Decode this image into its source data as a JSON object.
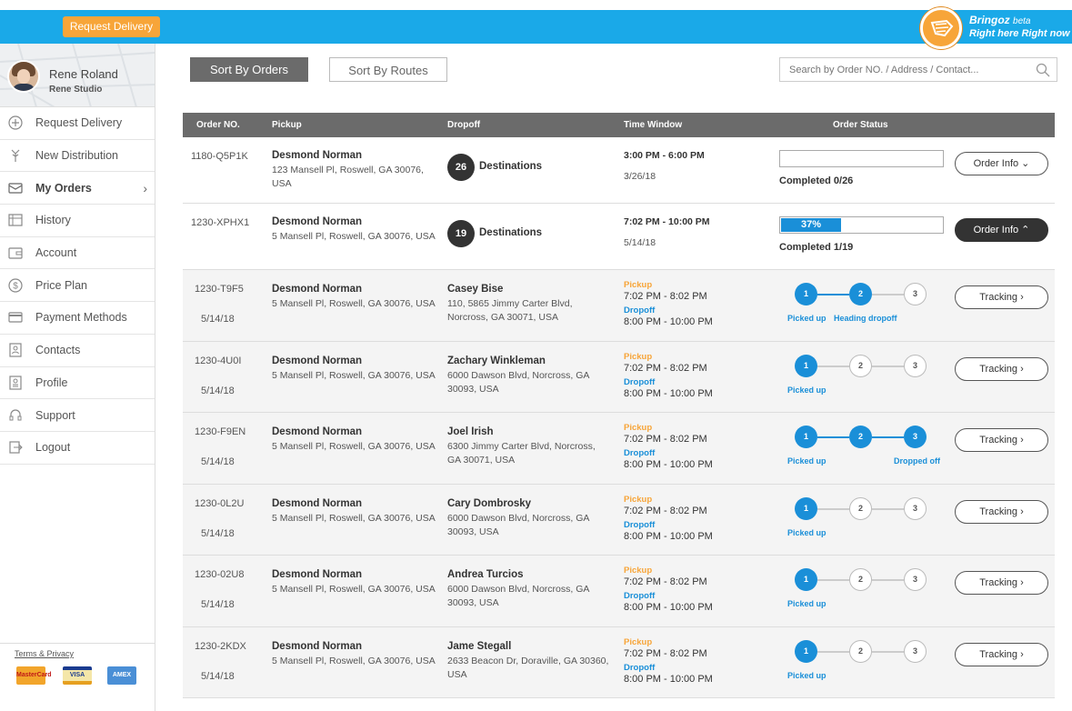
{
  "header": {
    "request_button": "Request Delivery",
    "brand_name": "Bringoz",
    "brand_beta": "beta",
    "brand_tagline": "Right here Right now",
    "colors": {
      "topbar": "#1aa9e8",
      "accent": "#f7a539",
      "blue": "#1a8fd8"
    }
  },
  "profile": {
    "name": "Rene Roland",
    "company": "Rene Studio"
  },
  "sidebar": {
    "items": [
      {
        "label": "Request Delivery",
        "icon": "plus-circle-icon"
      },
      {
        "label": "New Distribution",
        "icon": "fork-icon"
      },
      {
        "label": "My Orders",
        "icon": "inbox-icon",
        "active": true
      },
      {
        "label": "History",
        "icon": "history-icon"
      },
      {
        "label": "Account",
        "icon": "wallet-icon"
      },
      {
        "label": "Price Plan",
        "icon": "dollar-icon"
      },
      {
        "label": "Payment Methods",
        "icon": "credit-card-icon"
      },
      {
        "label": "Contacts",
        "icon": "contacts-icon"
      },
      {
        "label": "Profile",
        "icon": "profile-icon"
      },
      {
        "label": "Support",
        "icon": "headset-icon"
      },
      {
        "label": "Logout",
        "icon": "logout-icon"
      }
    ],
    "terms": "Terms & Privacy",
    "cards": [
      "MasterCard",
      "VISA",
      "AMEX"
    ]
  },
  "toolbar": {
    "sort_orders": "Sort By Orders",
    "sort_routes": "Sort By Routes",
    "search_placeholder": "Search by Order NO. / Address / Contact..."
  },
  "table": {
    "headers": {
      "order_no": "Order NO.",
      "pickup": "Pickup",
      "dropoff": "Dropoff",
      "time_window": "Time Window",
      "order_status": "Order Status"
    }
  },
  "routes": [
    {
      "order_no": "1180-Q5P1K",
      "pickup_name": "Desmond Norman",
      "pickup_addr": "123 Mansell Pl, Roswell, GA 30076, USA",
      "destinations_count": "26",
      "destinations_label": "Destinations",
      "time": "3:00 PM - 6:00 PM",
      "date": "3/26/18",
      "progress": 0,
      "progress_label": "",
      "completed": "Completed 0/26",
      "button": "Order Info ⌄"
    },
    {
      "order_no": "1230-XPHX1",
      "pickup_name": "Desmond Norman",
      "pickup_addr": "5 Mansell Pl, Roswell, GA 30076, USA",
      "destinations_count": "19",
      "destinations_label": "Destinations",
      "time": "7:02 PM - 10:00 PM",
      "date": "5/14/18",
      "progress": 0.37,
      "progress_label": "37%",
      "completed": "Completed 1/19",
      "button": "Order Info ⌃"
    }
  ],
  "orders": [
    {
      "order_no": "1230-T9F5",
      "date": "5/14/18",
      "pickup_name": "Desmond Norman",
      "pickup_addr": "5 Mansell Pl, Roswell, GA 30076, USA",
      "drop_name": "Casey Bise",
      "drop_addr": "110, 5865 Jimmy Carter Blvd, Norcross, GA 30071, USA",
      "pickup_label": "Pickup",
      "pickup_time": "7:02 PM - 8:02 PM",
      "dropoff_label": "Dropoff",
      "dropoff_time": "8:00 PM - 10:00 PM",
      "steps": [
        true,
        true,
        false
      ],
      "label1": "Picked up",
      "label2": "Heading dropoff",
      "label3": "",
      "button": "Tracking ›"
    },
    {
      "order_no": "1230-4U0I",
      "date": "5/14/18",
      "pickup_name": "Desmond Norman",
      "pickup_addr": "5 Mansell Pl, Roswell, GA 30076, USA",
      "drop_name": "Zachary Winkleman",
      "drop_addr": "6000 Dawson Blvd, Norcross, GA 30093, USA",
      "pickup_label": "Pickup",
      "pickup_time": "7:02 PM - 8:02 PM",
      "dropoff_label": "Dropoff",
      "dropoff_time": "8:00 PM - 10:00 PM",
      "steps": [
        true,
        false,
        false
      ],
      "label1": "Picked up",
      "label2": "",
      "label3": "",
      "button": "Tracking ›"
    },
    {
      "order_no": "1230-F9EN",
      "date": "5/14/18",
      "pickup_name": "Desmond Norman",
      "pickup_addr": "5 Mansell Pl, Roswell, GA 30076, USA",
      "drop_name": "Joel Irish",
      "drop_addr": "6300 Jimmy Carter Blvd, Norcross, GA 30071, USA",
      "pickup_label": "Pickup",
      "pickup_time": "7:02 PM - 8:02 PM",
      "dropoff_label": "Dropoff",
      "dropoff_time": "8:00 PM - 10:00 PM",
      "steps": [
        true,
        true,
        true
      ],
      "label1": "Picked up",
      "label2": "",
      "label3": "Dropped off",
      "button": "Tracking ›"
    },
    {
      "order_no": "1230-0L2U",
      "date": "5/14/18",
      "pickup_name": "Desmond Norman",
      "pickup_addr": "5 Mansell Pl, Roswell, GA 30076, USA",
      "drop_name": "Cary Dombrosky",
      "drop_addr": "6000 Dawson Blvd, Norcross, GA 30093, USA",
      "pickup_label": "Pickup",
      "pickup_time": "7:02 PM - 8:02 PM",
      "dropoff_label": "Dropoff",
      "dropoff_time": "8:00 PM - 10:00 PM",
      "steps": [
        true,
        false,
        false
      ],
      "label1": "Picked up",
      "label2": "",
      "label3": "",
      "button": "Tracking ›"
    },
    {
      "order_no": "1230-02U8",
      "date": "5/14/18",
      "pickup_name": "Desmond Norman",
      "pickup_addr": "5 Mansell Pl, Roswell, GA 30076, USA",
      "drop_name": "Andrea Turcios",
      "drop_addr": "6000 Dawson Blvd, Norcross, GA 30093, USA",
      "pickup_label": "Pickup",
      "pickup_time": "7:02 PM - 8:02 PM",
      "dropoff_label": "Dropoff",
      "dropoff_time": "8:00 PM - 10:00 PM",
      "steps": [
        true,
        false,
        false
      ],
      "label1": "Picked up",
      "label2": "",
      "label3": "",
      "button": "Tracking ›"
    },
    {
      "order_no": "1230-2KDX",
      "date": "5/14/18",
      "pickup_name": "Desmond Norman",
      "pickup_addr": "5 Mansell Pl, Roswell, GA 30076, USA",
      "drop_name": "Jame Stegall",
      "drop_addr": "2633 Beacon Dr, Doraville, GA 30360, USA",
      "pickup_label": "Pickup",
      "pickup_time": "7:02 PM - 8:02 PM",
      "dropoff_label": "Dropoff",
      "dropoff_time": "8:00 PM - 10:00 PM",
      "steps": [
        true,
        false,
        false
      ],
      "label1": "Picked up",
      "label2": "",
      "label3": "",
      "button": "Tracking ›"
    }
  ]
}
